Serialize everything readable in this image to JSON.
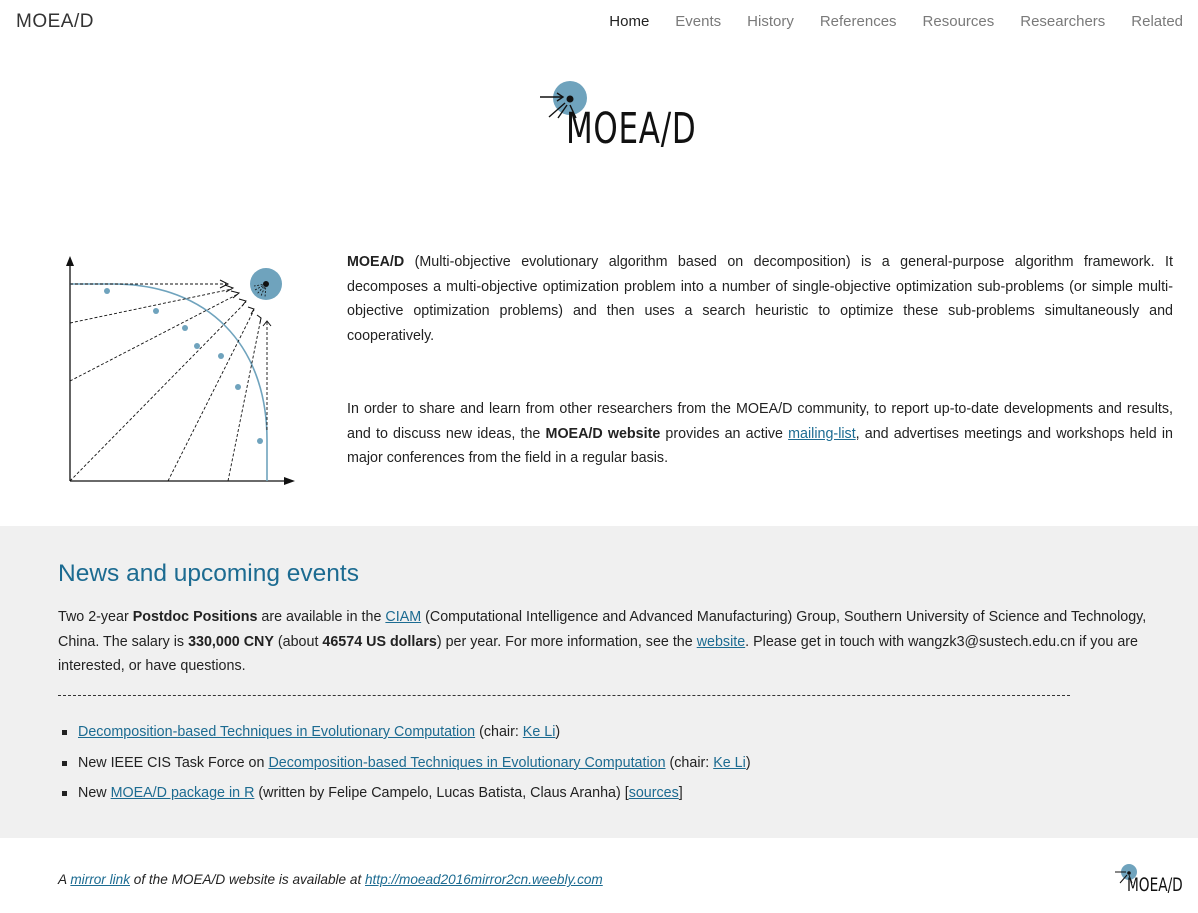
{
  "header": {
    "site_title": "MOEA/D",
    "nav": [
      "Home",
      "Events",
      "History",
      "References",
      "Resources",
      "Researchers",
      "Related"
    ]
  },
  "logo": {
    "text": "MOEA/D"
  },
  "intro": {
    "p1_bold": "MOEA/D",
    "p1_rest": " (Multi-objective evolutionary algorithm based on decomposition) is a general-purpose algorithm framework. It decomposes a multi-objective optimization problem into a number of single-objective optimization sub-problems (or simple multi-objective optimization problems) and then uses a search heuristic to optimize these sub-problems simultaneously and cooperatively.",
    "p2_a": "In order to share and learn from other researchers from the MOEA/D community, to report up-to-date developments and results, and to discuss new ideas, the ",
    "p2_bold": "MOEA/D website",
    "p2_b": " provides an active ",
    "p2_link": "mailing-list",
    "p2_c": ", and advertises meetings and workshops held in major conferences from the field in a regular basis."
  },
  "news": {
    "title": "News and upcoming events",
    "t1": "Two 2-year ",
    "b1": "Postdoc Positions",
    "t2": " are available in  the ",
    "link_ciam": "CIAM",
    "t3": " (Computational Intelligence and Advanced Manufacturing) Group, Southern University of Science and Technology, China. The salary is ",
    "b2": "330,000 CNY",
    "t4": "   (about ",
    "b3": "46574  US dollars",
    "t5": ")    per year. For more information, see the ",
    "link_website": "website",
    "t6": ". Please get in touch with wangzk3@sustech.edu.cn if you are interested, or have questions.",
    "items": [
      {
        "pre": " ",
        "link1": "Decomposition-based Techniques in Evolutionary Computation",
        "mid": " (chair: ",
        "link2": "Ke Li",
        "post": ")"
      },
      {
        "pre": "New IEEE CIS Task Force on ",
        "link1": "Decomposition-based Techniques in Evolutionary Computation",
        "mid": " (chair: ",
        "link2": "Ke Li",
        "post": ")"
      },
      {
        "pre": "New ",
        "link1": "MOEA/D package in R",
        "mid": " (written by Felipe Campelo, Lucas Batista, Claus Aranha) [",
        "link2": "sources",
        "post": "]"
      }
    ]
  },
  "footer": {
    "a": "A ",
    "link1": "mirror link",
    "b": " of the MOEA/D website is available at ",
    "link2": "http://moead2016mirror2cn.weebly.com"
  },
  "colors": {
    "accent": "#1c6b91",
    "logo_circle": "#6fa3bd",
    "news_bg": "#f0f0f0"
  },
  "icons": {
    "logo": "moead-logo-icon",
    "figure": "pareto-front-decomposition-figure"
  }
}
